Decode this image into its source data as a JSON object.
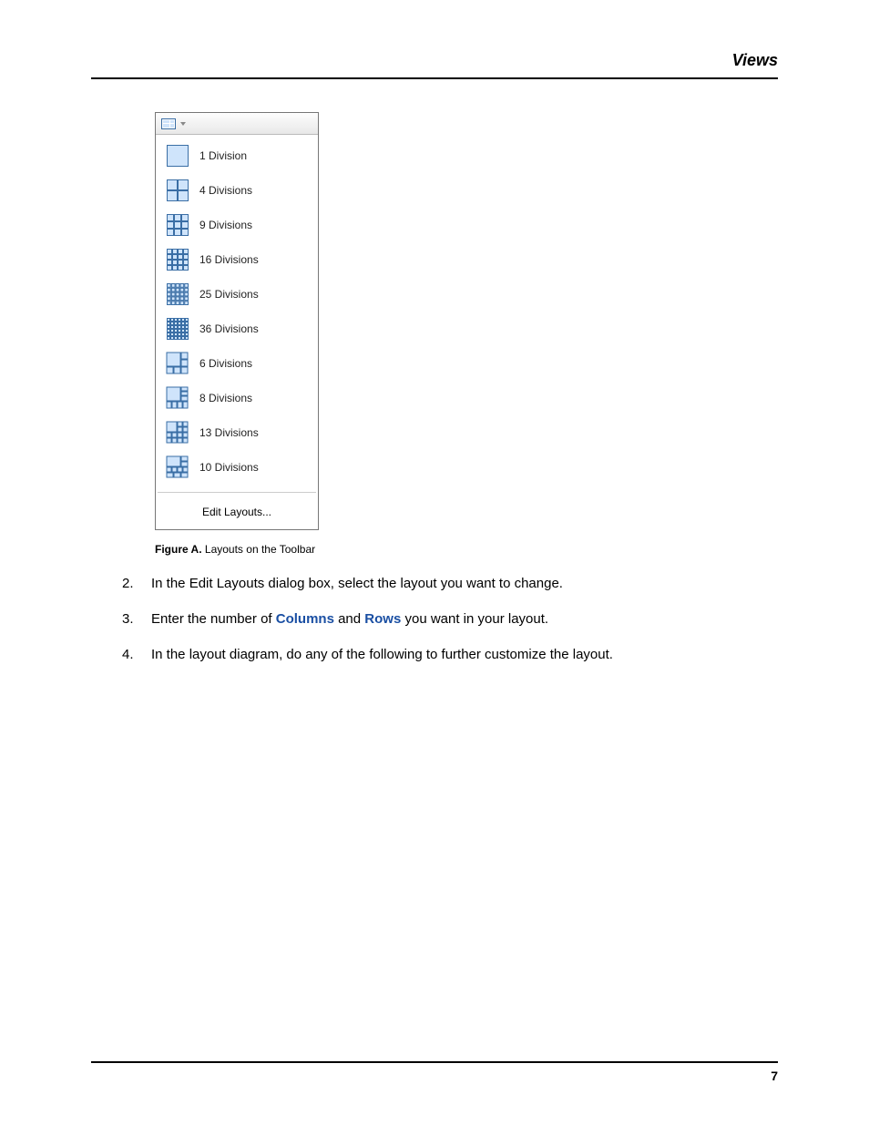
{
  "header": {
    "title": "Views"
  },
  "figure": {
    "label": "Figure A.",
    "caption": "Layouts on the Toolbar",
    "edit_label": "Edit Layouts...",
    "items": [
      {
        "label": "1 Division",
        "grid": [
          1,
          1
        ],
        "asym": null
      },
      {
        "label": "4 Divisions",
        "grid": [
          2,
          2
        ],
        "asym": null
      },
      {
        "label": "9 Divisions",
        "grid": [
          3,
          3
        ],
        "asym": null
      },
      {
        "label": "16 Divisions",
        "grid": [
          4,
          4
        ],
        "asym": null
      },
      {
        "label": "25 Divisions",
        "grid": [
          5,
          5
        ],
        "asym": null
      },
      {
        "label": "36 Divisions",
        "grid": [
          6,
          6
        ],
        "asym": null
      },
      {
        "label": "6 Divisions",
        "grid": null,
        "asym": "6"
      },
      {
        "label": "8 Divisions",
        "grid": null,
        "asym": "8"
      },
      {
        "label": "13 Divisions",
        "grid": null,
        "asym": "13"
      },
      {
        "label": "10 Divisions",
        "grid": null,
        "asym": "10"
      }
    ]
  },
  "steps": [
    {
      "num": "2.",
      "parts": [
        {
          "t": "In the Edit Layouts dialog box, select the layout you want to change."
        }
      ]
    },
    {
      "num": "3.",
      "parts": [
        {
          "t": "Enter the number of "
        },
        {
          "t": "Columns",
          "kw": true
        },
        {
          "t": " and "
        },
        {
          "t": "Rows",
          "kw": true
        },
        {
          "t": " you want in your layout."
        }
      ]
    },
    {
      "num": "4.",
      "parts": [
        {
          "t": "In the layout diagram, do any of the following to further customize the layout."
        }
      ]
    }
  ],
  "footer": {
    "page": "7"
  }
}
